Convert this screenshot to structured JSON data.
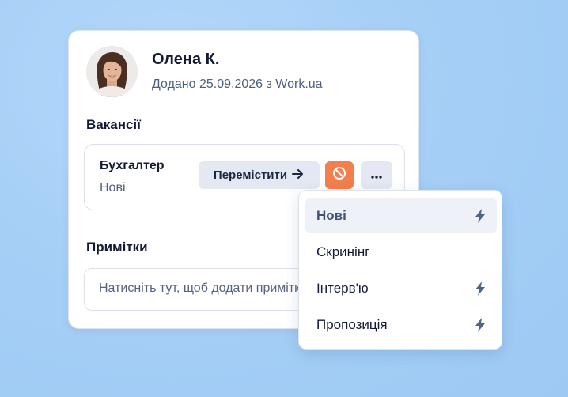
{
  "candidate": {
    "name": "Олена К.",
    "added": "Додано 25.09.2026 з Work.ua",
    "avatar_icon": "person-photo"
  },
  "vacancies": {
    "title": "Вакансії",
    "items": [
      {
        "title": "Бухгалтер",
        "stage": "Нові",
        "move_label": "Перемістити",
        "move_icon": "arrow-right-icon",
        "reject_icon": "block-icon",
        "more_icon": "ellipsis-icon"
      }
    ]
  },
  "notes": {
    "title": "Примітки",
    "placeholder": "Натисніть тут, щоб додати примітку"
  },
  "stage_menu": {
    "items": [
      {
        "label": "Нові",
        "active": true,
        "automation": true
      },
      {
        "label": "Скринінг",
        "active": false,
        "automation": false
      },
      {
        "label": "Інтерв'ю",
        "active": false,
        "automation": true
      },
      {
        "label": "Пропозиція",
        "active": false,
        "automation": true
      }
    ]
  },
  "colors": {
    "background": "#a9d1f7",
    "reject": "#f27f4c",
    "button_bg": "#e3e8f2",
    "accent_text": "#3f5379"
  }
}
